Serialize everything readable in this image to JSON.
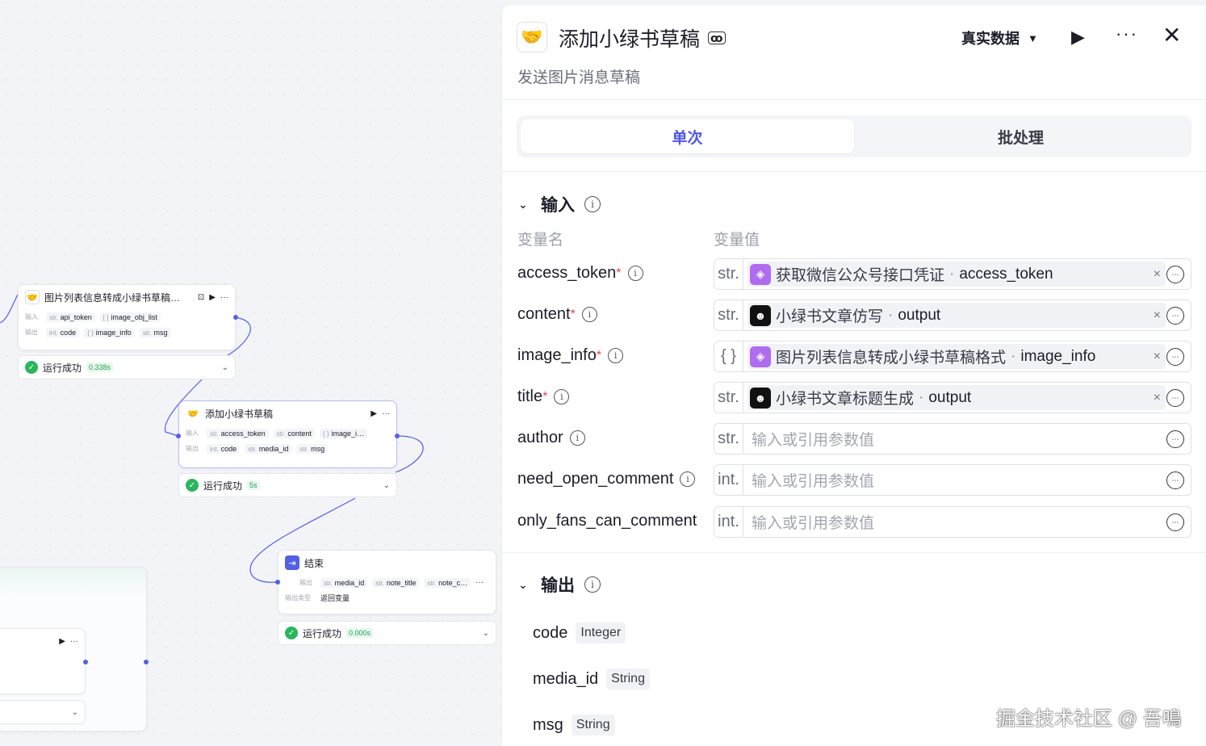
{
  "canvas": {
    "node1": {
      "title": "图片列表信息转成小绿书草稿…",
      "in_label": "输入",
      "out_label": "输出",
      "inputs": [
        {
          "t": "str.",
          "n": "api_token"
        },
        {
          "t": "[ ]",
          "n": "image_obj_list"
        }
      ],
      "outputs": [
        {
          "t": "int.",
          "n": "code"
        },
        {
          "t": "{ }",
          "n": "image_info"
        },
        {
          "t": "str.",
          "n": "msg"
        }
      ],
      "status": "运行成功",
      "time": "0.338s"
    },
    "node2": {
      "title": "添加小绿书草稿",
      "in_label": "输入",
      "out_label": "输出",
      "inputs": [
        {
          "t": "str.",
          "n": "access_token"
        },
        {
          "t": "str.",
          "n": "content"
        },
        {
          "t": "{ }",
          "n": "image_i…"
        }
      ],
      "outputs": [
        {
          "t": "int.",
          "n": "code"
        },
        {
          "t": "str.",
          "n": "media_id"
        },
        {
          "t": "str.",
          "n": "msg"
        }
      ],
      "status": "运行成功",
      "time": "5s"
    },
    "node3": {
      "title": "结束",
      "out_label": "输出",
      "outputs": [
        {
          "t": "str.",
          "n": "media_id"
        },
        {
          "t": "str.",
          "n": "note_title"
        },
        {
          "t": "str.",
          "n": "note_c…"
        }
      ],
      "ret_label": "输出类型",
      "ret_value": "返回变量",
      "status": "运行成功",
      "time": "0.000s"
    }
  },
  "panel": {
    "title": "添加小绿书草稿",
    "subtitle": "发送图片消息草稿",
    "data_mode": "真实数据",
    "tabs": [
      "单次",
      "批处理"
    ],
    "input_section": "输入",
    "col_name": "变量名",
    "col_value": "变量值",
    "inputs": [
      {
        "name": "access_token",
        "required": "*",
        "type": "str.",
        "ref_node": "获取微信公众号接口凭证",
        "ref_out": "access_token",
        "icon": "purple"
      },
      {
        "name": "content",
        "required": "*",
        "type": "str.",
        "ref_node": "小绿书文章仿写",
        "ref_out": "output",
        "icon": "black"
      },
      {
        "name": "image_info",
        "required": "*",
        "type": "{ }",
        "ref_node": "图片列表信息转成小绿书草稿格式",
        "ref_out": "image_info",
        "icon": "purple"
      },
      {
        "name": "title",
        "required": "*",
        "type": "str.",
        "ref_node": "小绿书文章标题生成",
        "ref_out": "output",
        "icon": "black"
      },
      {
        "name": "author",
        "required": "",
        "type": "str.",
        "placeholder": "输入或引用参数值"
      },
      {
        "name": "need_open_comment",
        "required": "",
        "type": "int.",
        "placeholder": "输入或引用参数值"
      },
      {
        "name": "only_fans_can_comment",
        "required": "",
        "type": "int.",
        "placeholder": "输入或引用参数值"
      }
    ],
    "output_section": "输出",
    "outputs": [
      {
        "name": "code",
        "type": "Integer"
      },
      {
        "name": "media_id",
        "type": "String"
      },
      {
        "name": "msg",
        "type": "String"
      }
    ]
  },
  "watermark": "掘金技术社区 @ 吾鳴"
}
